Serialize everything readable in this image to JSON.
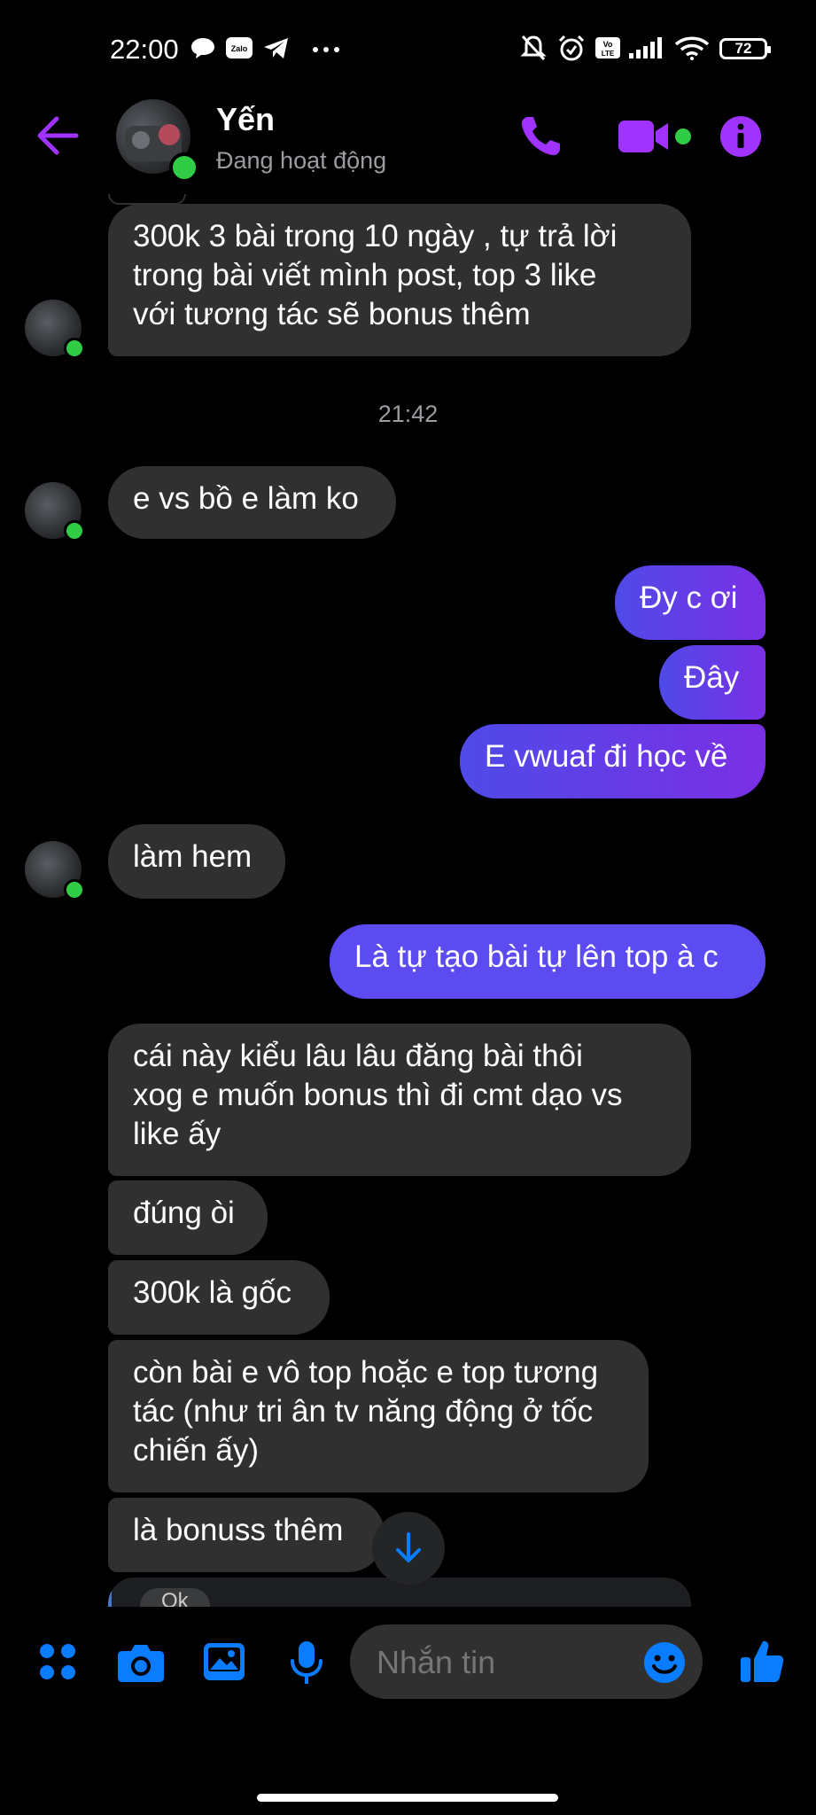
{
  "status_bar": {
    "time": "22:00",
    "battery": "72",
    "left_icons": [
      "chat-bubble-icon",
      "zalo-icon",
      "telegram-icon",
      "more-dots-icon"
    ],
    "right_icons": [
      "mute-bell-icon",
      "alarm-icon",
      "volte-icon",
      "signal-icon",
      "wifi-icon",
      "battery-icon"
    ]
  },
  "header": {
    "contact_name": "Yến",
    "contact_status": "Đang hoạt động",
    "accent_color": "#a033ff"
  },
  "messages": [
    {
      "side": "in",
      "text": "300k 3 bài trong 10 ngày , tự trả lời\ntrong bài viết mình post, top 3 like\nvới tương tác sẽ bonus thêm"
    },
    {
      "type": "timestamp",
      "text": "21:42"
    },
    {
      "side": "in",
      "text": "e vs bồ e làm ko"
    },
    {
      "side": "out",
      "text": "Đy c ơi"
    },
    {
      "side": "out",
      "text": "Đây"
    },
    {
      "side": "out",
      "text": "E vwuaf đi học về"
    },
    {
      "side": "in",
      "text": "làm hem"
    },
    {
      "side": "out",
      "text": "Là tự tạo bài tự lên top à c"
    },
    {
      "side": "in",
      "text": "cái này kiểu lâu lâu đăng bài thôi\nxog e muốn bonus thì đi cmt dạo vs\nlike ấy"
    },
    {
      "side": "in",
      "text": "đúng òi"
    },
    {
      "side": "in",
      "text": "300k là gốc"
    },
    {
      "side": "in",
      "text": "còn bài e vô top hoặc e top tương\ntác (như tri ân tv năng động ở tốc\nchiến ấy)"
    },
    {
      "side": "in",
      "text": "là bonuss thêm"
    },
    {
      "side": "in",
      "type": "partial",
      "text": "Ok"
    }
  ],
  "composer": {
    "placeholder": "Nhắn tin",
    "icons": [
      "apps-grid-icon",
      "camera-icon",
      "gallery-icon",
      "microphone-icon",
      "emoji-icon",
      "thumbs-up-icon"
    ],
    "icon_color": "#0a7cff"
  }
}
